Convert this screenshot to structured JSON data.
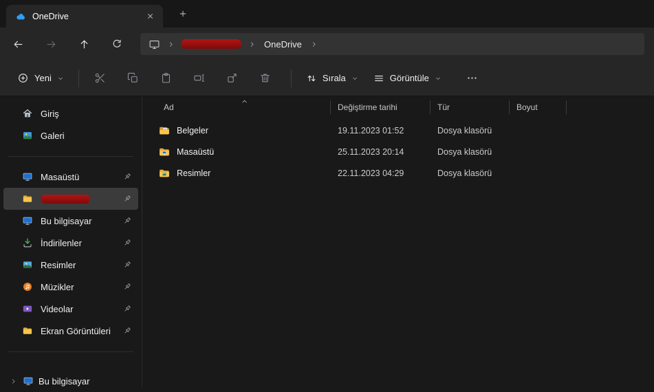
{
  "window": {
    "tab_title": "OneDrive"
  },
  "navigation": {
    "breadcrumb": {
      "segments": [
        {
          "label": "",
          "redacted": true
        },
        {
          "label": "OneDrive",
          "redacted": false
        }
      ]
    }
  },
  "toolbar": {
    "new_label": "Yeni",
    "sort_label": "Sırala",
    "view_label": "Görüntüle"
  },
  "sidebar": {
    "items": [
      {
        "label": "Giriş",
        "pinned": false,
        "selected": false,
        "redacted": false
      },
      {
        "label": "Galeri",
        "pinned": false,
        "selected": false,
        "redacted": false
      },
      {
        "label": "Masaüstü",
        "pinned": true,
        "selected": false,
        "redacted": false
      },
      {
        "label": "",
        "pinned": true,
        "selected": true,
        "redacted": true
      },
      {
        "label": "Bu bilgisayar",
        "pinned": true,
        "selected": false,
        "redacted": false
      },
      {
        "label": "İndirilenler",
        "pinned": true,
        "selected": false,
        "redacted": false
      },
      {
        "label": "Resimler",
        "pinned": true,
        "selected": false,
        "redacted": false
      },
      {
        "label": "Müzikler",
        "pinned": true,
        "selected": false,
        "redacted": false
      },
      {
        "label": "Videolar",
        "pinned": true,
        "selected": false,
        "redacted": false
      },
      {
        "label": "Ekran Görüntüleri",
        "pinned": true,
        "selected": false,
        "redacted": false
      }
    ],
    "tree": [
      {
        "label": "Bu bilgisayar",
        "expandable": true
      }
    ]
  },
  "file_list": {
    "columns": [
      {
        "label": "Ad",
        "sorted": "asc"
      },
      {
        "label": "Değiştirme tarihi",
        "sorted": ""
      },
      {
        "label": "Tür",
        "sorted": ""
      },
      {
        "label": "Boyut",
        "sorted": ""
      }
    ],
    "rows": [
      {
        "name": "Belgeler",
        "date_modified": "19.11.2023 01:52",
        "type": "Dosya klasörü",
        "size": "",
        "icon": "documents-folder-icon"
      },
      {
        "name": "Masaüstü",
        "date_modified": "25.11.2023 20:14",
        "type": "Dosya klasörü",
        "size": "",
        "icon": "desktop-folder-icon"
      },
      {
        "name": "Resimler",
        "date_modified": "22.11.2023 04:29",
        "type": "Dosya klasörü",
        "size": "",
        "icon": "pictures-folder-icon"
      }
    ]
  },
  "icons": [
    "onedrive-cloud-icon",
    "close-icon",
    "new-tab-plus-icon",
    "back-icon",
    "forward-icon",
    "up-icon",
    "refresh-icon",
    "monitor-icon",
    "breadcrumb-chevron-icon",
    "new-item-plus-icon",
    "chevron-down-icon",
    "cut-icon",
    "copy-icon",
    "paste-icon",
    "rename-icon",
    "share-icon",
    "delete-icon",
    "sort-icon",
    "view-list-icon",
    "more-icon",
    "home-icon",
    "gallery-icon",
    "desktop-icon",
    "folder-icon",
    "this-pc-icon",
    "downloads-icon",
    "pictures-icon",
    "music-icon",
    "videos-icon",
    "pin-icon",
    "chevron-right-icon",
    "sort-ascending-chevron-icon",
    "documents-folder-icon",
    "desktop-folder-icon",
    "pictures-folder-icon"
  ],
  "colors": {
    "accent_cloud_blue": "#2f9df4",
    "folder_yellow": "#f8c64b",
    "redaction_red": "#a01010",
    "selection_gray": "#3b3b3b",
    "header_mica": "#262626",
    "titlebar": "#171717",
    "content_bg": "#191919"
  }
}
